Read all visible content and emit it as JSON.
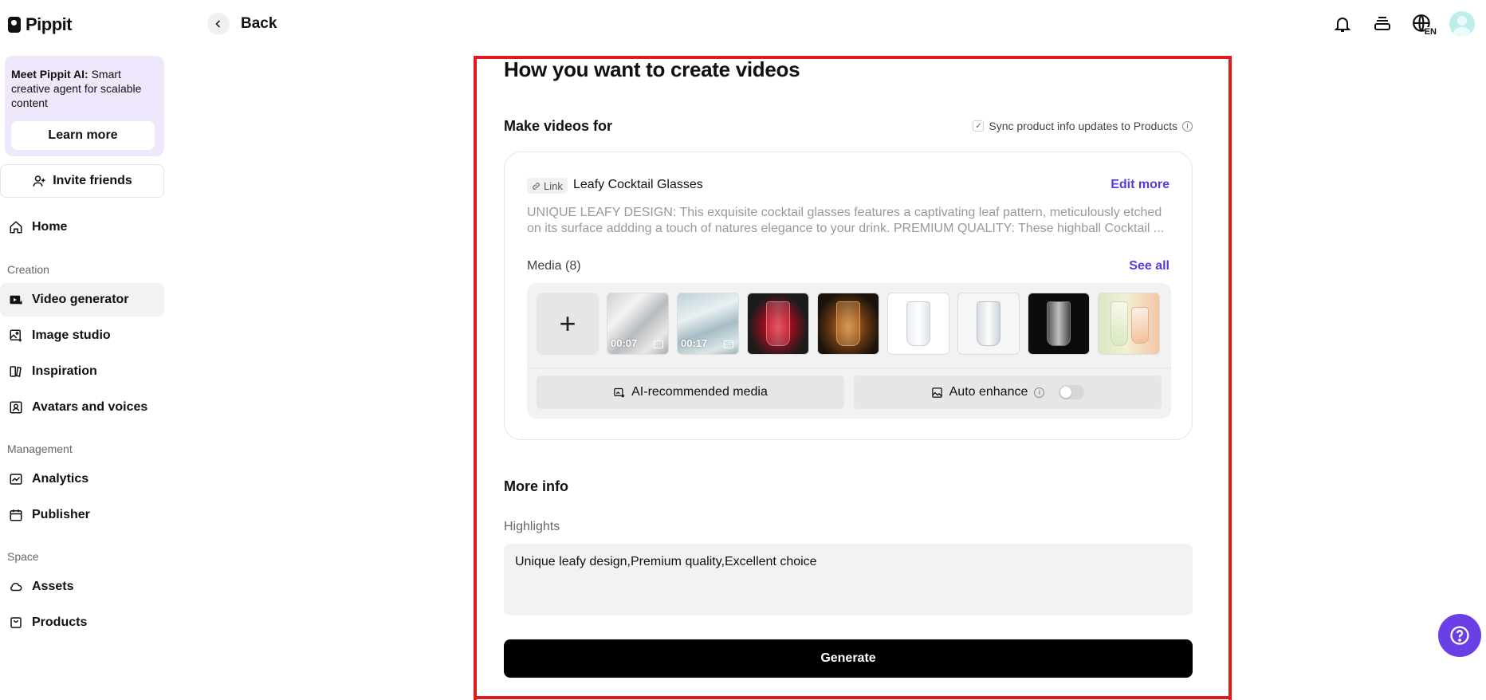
{
  "brand": {
    "name": "Pippit"
  },
  "sidebar": {
    "promo": {
      "bold": "Meet Pippit AI:",
      "text": " Smart creative agent for scalable content",
      "button": "Learn more"
    },
    "invite": "Invite friends",
    "home": "Home",
    "sections": {
      "creation": "Creation",
      "management": "Management",
      "space": "Space"
    },
    "items": {
      "video_generator": "Video generator",
      "image_studio": "Image studio",
      "inspiration": "Inspiration",
      "avatars": "Avatars and voices",
      "analytics": "Analytics",
      "publisher": "Publisher",
      "assets": "Assets",
      "products": "Products"
    }
  },
  "topbar": {
    "back": "Back",
    "language": "EN"
  },
  "main": {
    "title": "How you want to create videos",
    "make_videos_for": "Make videos for",
    "sync_label": "Sync product info updates to Products",
    "product": {
      "chip": "Link",
      "title": "Leafy Cocktail Glasses",
      "edit": "Edit more",
      "description": "UNIQUE LEAFY DESIGN: This exquisite cocktail glasses features a captivating leaf pattern, meticulously etched on its surface addding a touch of natures elegance to your drink. PREMIUM QUALITY: These highball Cocktail ..."
    },
    "media": {
      "label": "Media (8)",
      "see_all": "See all",
      "thumbs": [
        {
          "duration": "00:07"
        },
        {
          "duration": "00:17"
        }
      ],
      "ai_recommended": "AI-recommended media",
      "auto_enhance": "Auto enhance"
    },
    "more_info": "More info",
    "highlights_label": "Highlights",
    "highlights_value": "Unique leafy design,Premium quality,Excellent choice",
    "generate": "Generate"
  },
  "colors": {
    "accent": "#5a3ae0",
    "promo_bg": "#efe8fd",
    "frame": "#e01b1b",
    "help": "#6a3fe6"
  }
}
